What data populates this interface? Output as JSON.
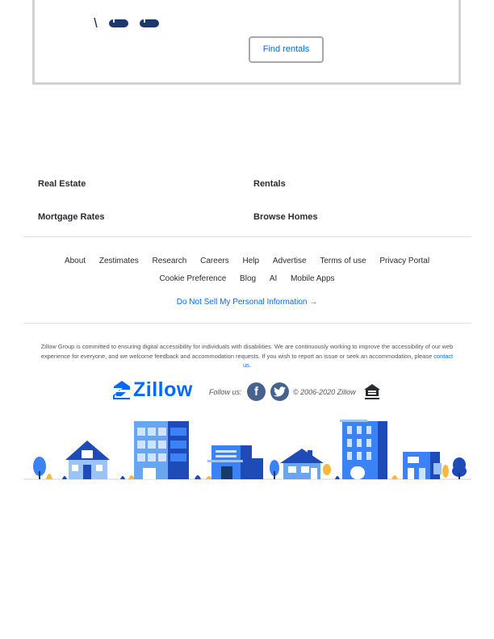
{
  "card": {
    "find_button_label": "Find rentals"
  },
  "link_groups": [
    {
      "label": "Real Estate"
    },
    {
      "label": "Rentals"
    },
    {
      "label": "Mortgage Rates"
    },
    {
      "label": "Browse Homes"
    }
  ],
  "nav_primary": [
    "About",
    "Zestimates",
    "Research",
    "Careers",
    "Help",
    "Advertise",
    "Terms of use",
    "Privacy Portal"
  ],
  "nav_secondary": [
    "Cookie Preference",
    "Blog",
    "AI",
    "Mobile Apps"
  ],
  "do_not_sell": "Do Not Sell My Personal Information →",
  "accessibility": {
    "text": "Zillow Group is committed to ensuring digital accessibility for individuals with disabilities. We are continuously working to improve the accessibility of our web experience for everyone, and we welcome feedback and accommodation requests. If you wish to report an issue or seek an accommodation, please",
    "link": "contact us",
    "end": "."
  },
  "brand": {
    "logo_text": "Zillow",
    "follow_label": "Follow us:",
    "social_icons": [
      "facebook-icon",
      "twitter-icon"
    ],
    "copyright": "© 2006-2020 Zillow",
    "brand_color": "#006aff"
  }
}
